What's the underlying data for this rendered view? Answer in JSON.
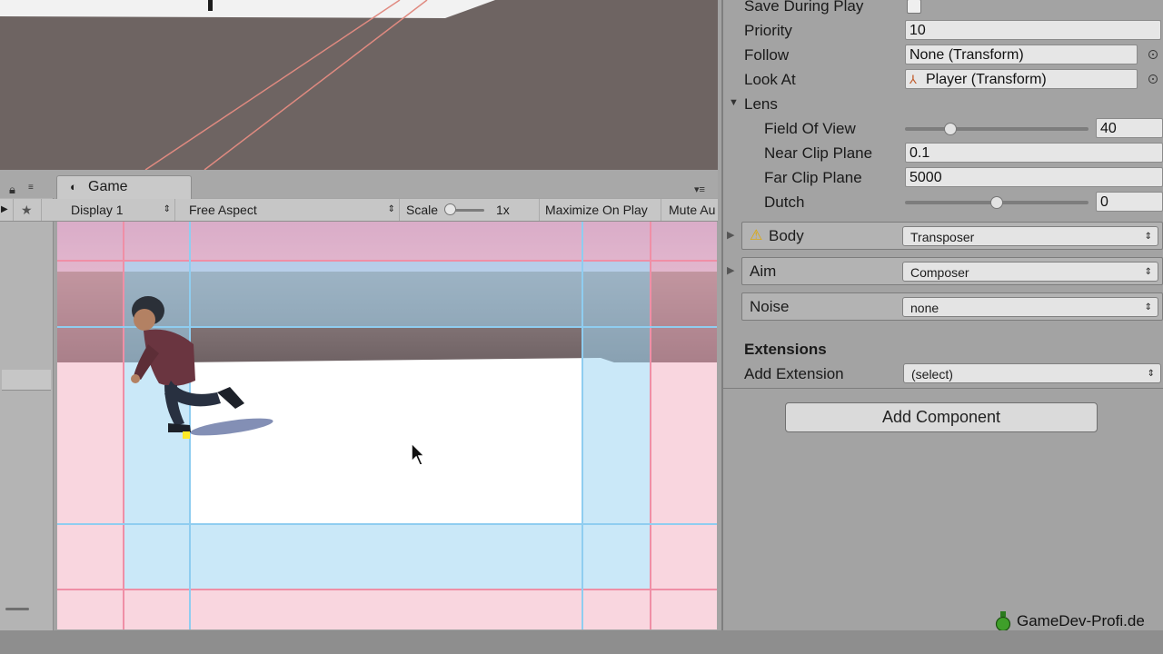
{
  "game_tab": {
    "title": "Game"
  },
  "game_toolbar": {
    "display": "Display 1",
    "aspect": "Free Aspect",
    "scale_label": "Scale",
    "scale_value": "1x",
    "maximize": "Maximize On Play",
    "mute": "Mute Au"
  },
  "inspector": {
    "save_during_play": {
      "label": "Save During Play",
      "checked": false
    },
    "priority": {
      "label": "Priority",
      "value": "10"
    },
    "follow": {
      "label": "Follow",
      "value": "None (Transform)"
    },
    "look_at": {
      "label": "Look At",
      "value": "Player (Transform)"
    },
    "lens": {
      "label": "Lens",
      "field_of_view": {
        "label": "Field Of View",
        "value": "40",
        "slider_fraction": 0.23
      },
      "near_clip": {
        "label": "Near Clip Plane",
        "value": "0.1"
      },
      "far_clip": {
        "label": "Far Clip Plane",
        "value": "5000"
      },
      "dutch": {
        "label": "Dutch",
        "value": "0",
        "slider_fraction": 0.5
      }
    },
    "body": {
      "label": "Body",
      "value": "Transposer"
    },
    "aim": {
      "label": "Aim",
      "value": "Composer"
    },
    "noise": {
      "label": "Noise",
      "value": "none"
    },
    "extensions": {
      "title": "Extensions",
      "add_label": "Add Extension",
      "add_value": "(select)"
    },
    "add_component": "Add Component"
  },
  "watermark": "GameDev-Profi.de",
  "colors": {
    "scene_ground": "#6e6462",
    "panel_bg": "#a3a3a3",
    "guide_pink": "#f8c6d2",
    "guide_blue": "#c7e6f7"
  }
}
